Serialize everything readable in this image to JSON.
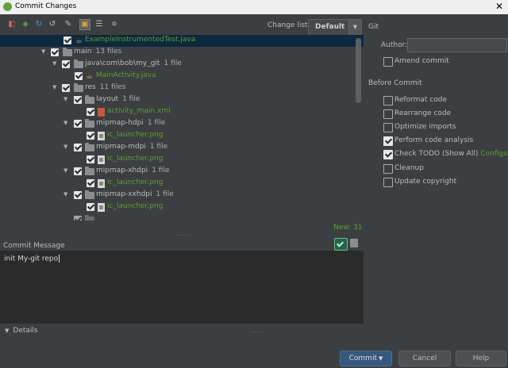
{
  "window": {
    "title": "Commit Changes",
    "close_glyph": "✕"
  },
  "toolbar": {
    "icons": [
      "diff-icon",
      "move-icon",
      "refresh-icon",
      "revert-icon",
      "edit-icon",
      "group-icon",
      "expand-all-icon",
      "collapse-all-icon"
    ]
  },
  "changelist": {
    "label": "Change list:",
    "value": "Default"
  },
  "tree": {
    "rows": [
      {
        "label": "ExampleInstrumentedTest.java",
        "count": "",
        "type": "java",
        "green": true,
        "selected": true
      },
      {
        "label": "main",
        "count": "13 files",
        "type": "folder",
        "green": false,
        "expanded": true
      },
      {
        "label": "java\\com\\bob\\my_git",
        "count": "1 file",
        "type": "folder",
        "green": false,
        "expanded": true
      },
      {
        "label": "MainActivity.java",
        "count": "",
        "type": "java",
        "green": true
      },
      {
        "label": "res",
        "count": "11 files",
        "type": "folder",
        "green": false,
        "expanded": true
      },
      {
        "label": "layout",
        "count": "1 file",
        "type": "folder",
        "green": false,
        "expanded": true
      },
      {
        "label": "activity_main.xml",
        "count": "",
        "type": "xml",
        "green": true
      },
      {
        "label": "mipmap-hdpi",
        "count": "1 file",
        "type": "folder",
        "green": false,
        "expanded": true
      },
      {
        "label": "ic_launcher.png",
        "count": "",
        "type": "png",
        "green": true
      },
      {
        "label": "mipmap-mdpi",
        "count": "1 file",
        "type": "folder",
        "green": false,
        "expanded": true
      },
      {
        "label": "ic_launcher.png",
        "count": "",
        "type": "png",
        "green": true
      },
      {
        "label": "mipmap-xhdpi",
        "count": "1 file",
        "type": "folder",
        "green": false,
        "expanded": true
      },
      {
        "label": "ic_launcher.png",
        "count": "",
        "type": "png",
        "green": true
      },
      {
        "label": "mipmap-xxhdpi",
        "count": "1 file",
        "type": "folder",
        "green": false,
        "expanded": true
      },
      {
        "label": "ic_launcher.png",
        "count": "",
        "type": "png",
        "green": true
      }
    ],
    "new_count": "New: 31"
  },
  "commit_message": {
    "label": "Commit Message",
    "text": "init My-git repo"
  },
  "details": {
    "label": "Details"
  },
  "git": {
    "heading": "Git",
    "author_label": "Author:",
    "author_value": "",
    "amend_label": "Amend commit",
    "amend_checked": false
  },
  "before_commit": {
    "heading": "Before Commit",
    "options": [
      {
        "label": "Reformat code",
        "checked": false
      },
      {
        "label": "Rearrange code",
        "checked": false
      },
      {
        "label": "Optimize imports",
        "checked": false
      },
      {
        "label": "Perform code analysis",
        "checked": true
      },
      {
        "label": "Check TODO (Show All)",
        "checked": true,
        "link": "Configure"
      },
      {
        "label": "Cleanup",
        "checked": false
      },
      {
        "label": "Update copyright",
        "checked": false
      }
    ]
  },
  "buttons": {
    "commit": "Commit",
    "cancel": "Cancel",
    "help": "Help"
  }
}
